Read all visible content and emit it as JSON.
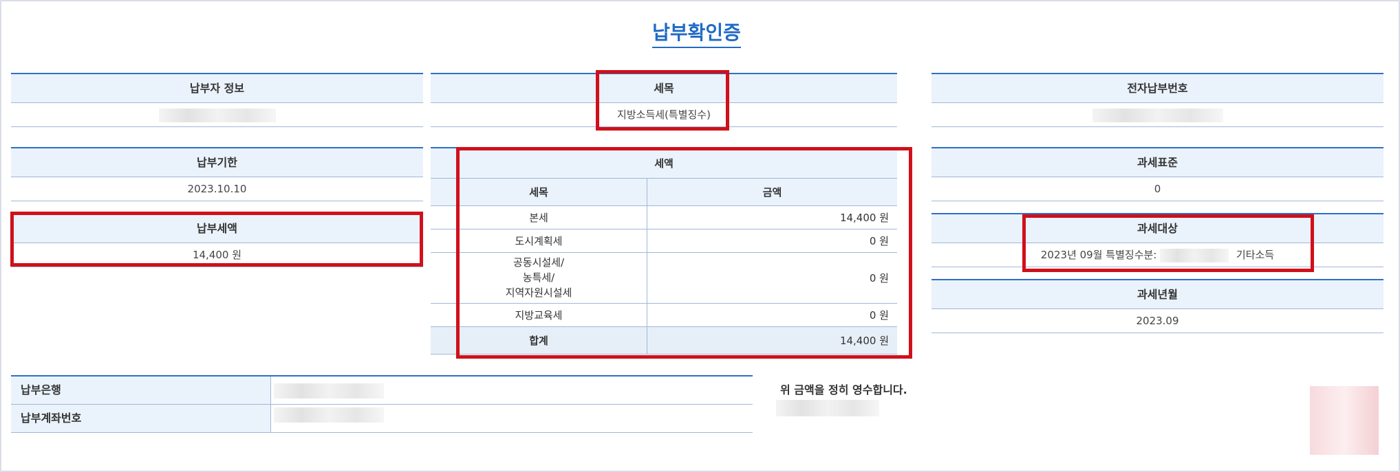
{
  "title": "납부확인증",
  "payer_info": {
    "header": "납부자 정보",
    "value": ""
  },
  "tax_item": {
    "header": "세목",
    "value": "지방소득세(특별징수)"
  },
  "electronic_payment_no": {
    "header": "전자납부번호",
    "value": ""
  },
  "due_date": {
    "header": "납부기한",
    "value": "2023.10.10"
  },
  "tax_amount_paid": {
    "header": "납부세액",
    "value": "14,400 원"
  },
  "tax_base": {
    "header": "과세표준",
    "value": "0"
  },
  "tax_target": {
    "header": "과세대상",
    "value_prefix": "2023년 09월 특별징수분:",
    "value_suffix": "기타소득"
  },
  "tax_period": {
    "header": "과세년월",
    "value": "2023.09"
  },
  "tax_detail": {
    "header": "세액",
    "col_item": "세목",
    "col_amount": "금액",
    "rows": [
      {
        "item": "본세",
        "amount": "14,400 원"
      },
      {
        "item": "도시계획세",
        "amount": "0 원"
      },
      {
        "item_lines": [
          "공동시설세/",
          "농특세/",
          "지역자원시설세"
        ],
        "amount": "0 원"
      },
      {
        "item": "지방교육세",
        "amount": "0 원"
      }
    ],
    "total": {
      "item": "합계",
      "amount": "14,400 원"
    }
  },
  "bank": {
    "bank_label": "납부은행",
    "account_label": "납부계좌번호"
  },
  "receipt_text": "위 금액을 정히 영수합니다.",
  "colors": {
    "accent": "#2d6fc7",
    "header_bg": "#eaf2fb",
    "highlight": "#d0101a"
  }
}
